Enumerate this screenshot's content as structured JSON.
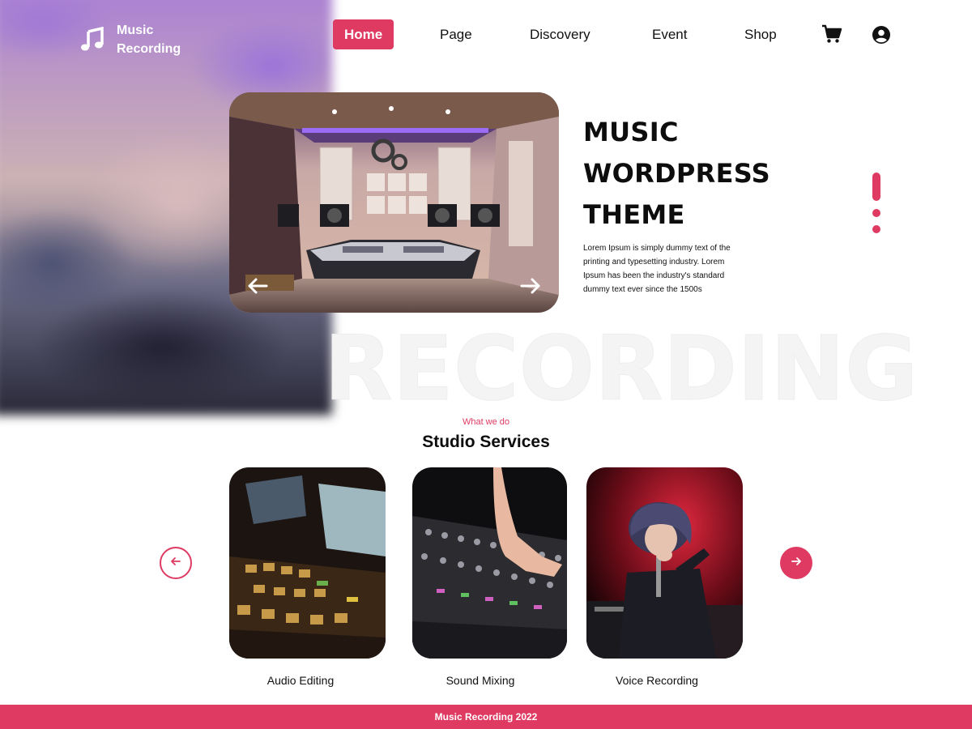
{
  "header": {
    "logo_line1": "Music",
    "logo_line2": "Recording",
    "nav": [
      {
        "label": "Home",
        "active": true
      },
      {
        "label": "Page",
        "active": false
      },
      {
        "label": "Discovery",
        "active": false
      },
      {
        "label": "Event",
        "active": false
      },
      {
        "label": "Shop",
        "active": false
      }
    ],
    "icons": [
      "music-note-icon",
      "cart-icon",
      "user-icon"
    ]
  },
  "hero": {
    "title_line1": "MUSIC",
    "title_line2": "WORDPRESS",
    "title_line3": "THEME",
    "description": "Lorem Ipsum is simply dummy text of the printing and typesetting industry. Lorem Ipsum has been the industry's standard dummy text ever since the 1500s",
    "watermark": "RECORDING",
    "slide_indicators": 3,
    "active_slide": 1
  },
  "services": {
    "eyebrow": "What we do",
    "title": "Studio Services",
    "cards": [
      {
        "label": "Audio Editing"
      },
      {
        "label": "Sound Mixing"
      },
      {
        "label": "Voice Recording"
      }
    ]
  },
  "footer": {
    "text": "Music Recording 2022"
  },
  "colors": {
    "accent": "#de3a62",
    "text": "#0d0d0d",
    "background": "#ffffff"
  }
}
